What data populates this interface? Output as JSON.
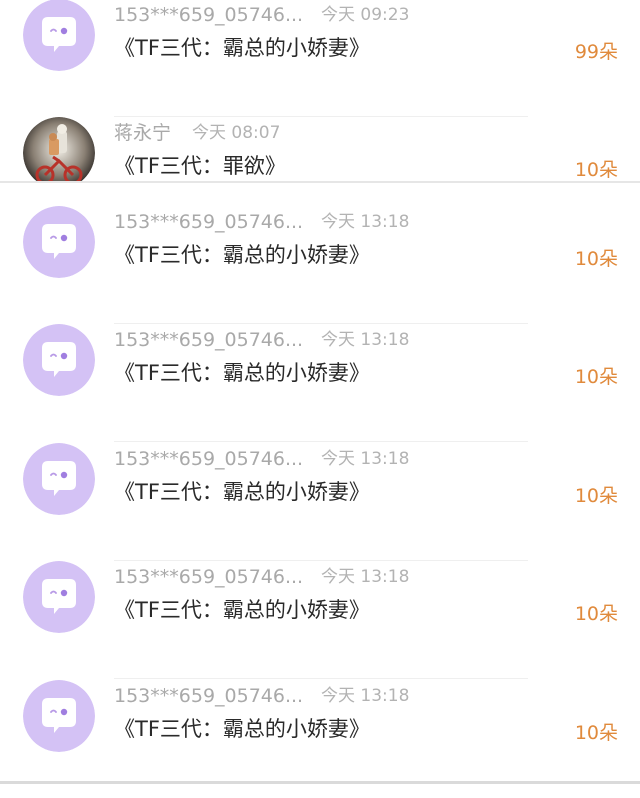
{
  "messages": [
    {
      "name": "153***659_05746...",
      "time": "今天 09:23",
      "title": "《TF三代：霸总的小娇妻》",
      "count": "99朵",
      "avatar": "speech-bubble-avatar"
    },
    {
      "name": "蒋永宁",
      "time": "今天 08:07",
      "title": "《TF三代：罪欲》",
      "count": "10朵",
      "avatar": "photo-avatar"
    },
    {
      "name": "153***659_05746...",
      "time": "今天 13:18",
      "title": "《TF三代：霸总的小娇妻》",
      "count": "10朵",
      "avatar": "speech-bubble-avatar"
    },
    {
      "name": "153***659_05746...",
      "time": "今天 13:18",
      "title": "《TF三代：霸总的小娇妻》",
      "count": "10朵",
      "avatar": "speech-bubble-avatar"
    },
    {
      "name": "153***659_05746...",
      "time": "今天 13:18",
      "title": "《TF三代：霸总的小娇妻》",
      "count": "10朵",
      "avatar": "speech-bubble-avatar"
    },
    {
      "name": "153***659_05746...",
      "time": "今天 13:18",
      "title": "《TF三代：霸总的小娇妻》",
      "count": "10朵",
      "avatar": "speech-bubble-avatar"
    },
    {
      "name": "153***659_05746...",
      "time": "今天 13:18",
      "title": "《TF三代：霸总的小娇妻》",
      "count": "10朵",
      "avatar": "speech-bubble-avatar"
    }
  ],
  "colors": {
    "avatar_bg": "#d4c2f5",
    "count_accent": "#e08a3c"
  }
}
